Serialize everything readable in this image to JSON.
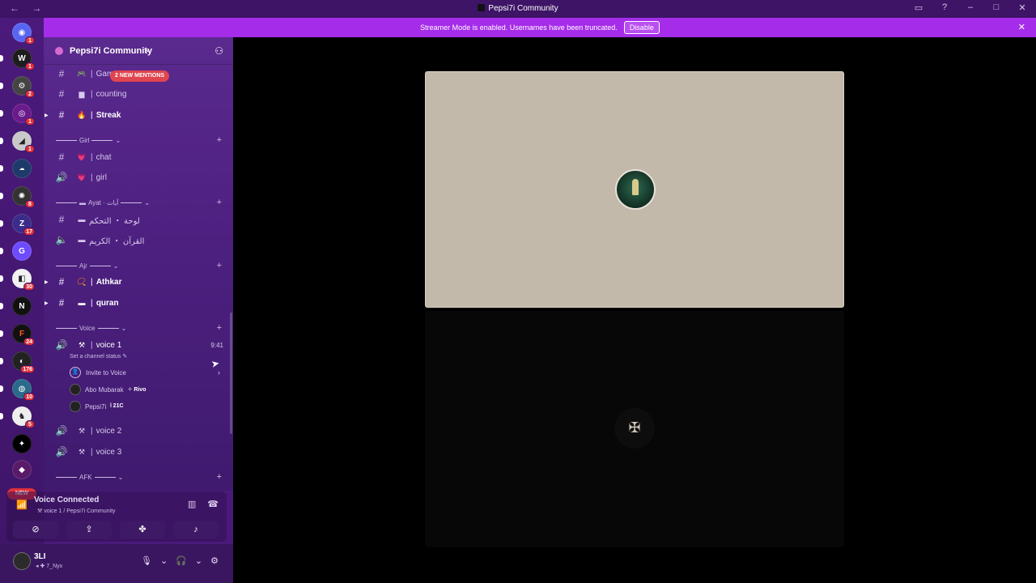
{
  "window": {
    "title": "Pepsi7i Community",
    "nav": "← →"
  },
  "banner": {
    "text": "Streamer Mode is enabled. Usernames have been truncated.",
    "disable_label": "Disable"
  },
  "servers": {
    "badges": [
      "1",
      "1",
      "2",
      "1",
      "1",
      "",
      "",
      "8",
      "17",
      "",
      "30",
      "",
      "24",
      "176",
      "10",
      "5",
      ""
    ],
    "new_label": "NEW"
  },
  "server": {
    "name": "Pepsi7i Community",
    "new_mentions": "2 NEW MENTIONS"
  },
  "channels": {
    "game": "Gam",
    "counting": "counting",
    "streak": "Streak",
    "cat_girl": "Girl",
    "chat": "chat",
    "girl": "girl",
    "cat_ayat": "Ayat · آيات",
    "ar_board": "لوحة ・ التحكم",
    "ar_quran": "القرآن ・ الكريم",
    "cat_ajr": "Ajr",
    "athkar": "Athkar",
    "quran": "quran",
    "cat_voice": "Voice",
    "voice1": "voice 1",
    "voice1_time": "9:41",
    "set_status": "Set a channel status",
    "invite": "Invite to Voice",
    "member1": "Abo Mubarak",
    "member1_tag": "Rivo",
    "member2": "Pepsi7i",
    "member2_tag": "21C",
    "voice2": "voice 2",
    "voice3": "voice 3",
    "cat_afk": "AFK",
    "separator": "|"
  },
  "voice_panel": {
    "status": "Voice Connected",
    "location": "voice 1 / Pepsi7i Community"
  },
  "user": {
    "name": "3LI",
    "status": "7_Nyx"
  },
  "colors": {
    "banner": "#a52ce8",
    "sidebar": "#5a2a8e",
    "rail": "#4b1a7c",
    "badge": "#e0313b",
    "tile_light": "#c3b9ab",
    "tile_dark": "#070707"
  }
}
